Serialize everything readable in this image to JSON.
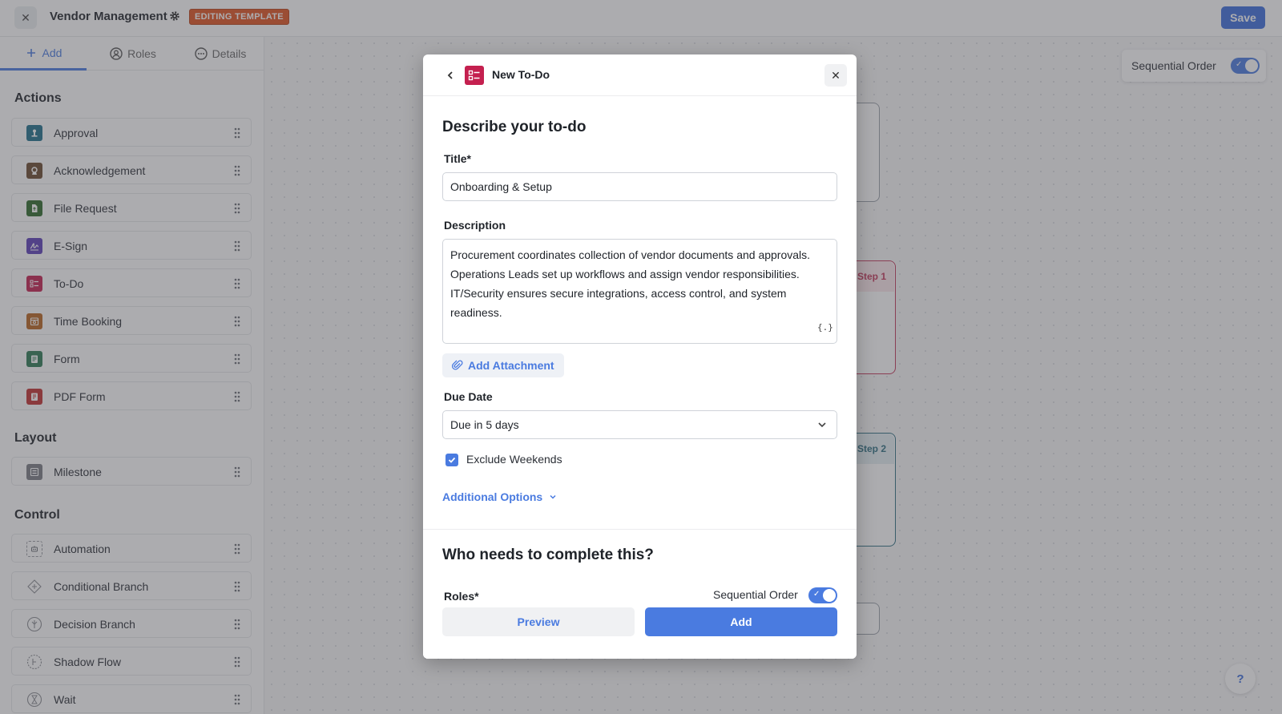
{
  "topbar": {
    "close_icon": "x-icon",
    "title": "Vendor Management",
    "settings_icon": "gear-icon",
    "badge": "EDITING TEMPLATE",
    "save_label": "Save"
  },
  "sidebar": {
    "tabs": [
      {
        "label": "Add",
        "icon": "plus-icon",
        "active": true
      },
      {
        "label": "Roles",
        "icon": "user-circle-icon",
        "active": false
      },
      {
        "label": "Details",
        "icon": "ellipsis-circle-icon",
        "active": false
      }
    ],
    "sections": [
      {
        "title": "Actions",
        "items": [
          {
            "label": "Approval",
            "icon": "approval-icon",
            "color": "#1f6f8b"
          },
          {
            "label": "Acknowledgement",
            "icon": "acknowledgement-icon",
            "color": "#6b4a2e"
          },
          {
            "label": "File Request",
            "icon": "file-request-icon",
            "color": "#2f6b2a"
          },
          {
            "label": "E-Sign",
            "icon": "signature-icon",
            "color": "#5b3fb8"
          },
          {
            "label": "To-Do",
            "icon": "todo-list-icon",
            "color": "#c4204f"
          },
          {
            "label": "Time Booking",
            "icon": "calendar-icon",
            "color": "#b8651f"
          },
          {
            "label": "Form",
            "icon": "form-icon",
            "color": "#2f7a55"
          },
          {
            "label": "PDF Form",
            "icon": "pdf-form-icon",
            "color": "#c23030"
          }
        ]
      },
      {
        "title": "Layout",
        "items": [
          {
            "label": "Milestone",
            "icon": "milestone-icon",
            "color": "#7a7d84"
          }
        ]
      },
      {
        "title": "Control",
        "items": [
          {
            "label": "Automation",
            "icon": "automation-icon",
            "color": "#9a9ca2"
          },
          {
            "label": "Conditional Branch",
            "icon": "conditional-branch-icon",
            "color": "#9a9ca2"
          },
          {
            "label": "Decision Branch",
            "icon": "decision-branch-icon",
            "color": "#9a9ca2"
          },
          {
            "label": "Shadow Flow",
            "icon": "shadow-flow-icon",
            "color": "#9a9ca2"
          },
          {
            "label": "Wait",
            "icon": "hourglass-icon",
            "color": "#9a9ca2"
          }
        ]
      }
    ]
  },
  "canvas": {
    "sequential_label": "Sequential Order",
    "sequential_on": true,
    "step1_label": "Step 1",
    "step2_label": "Step 2",
    "help_label": "?"
  },
  "modal": {
    "back_icon": "chevron-left-icon",
    "header_icon": "todo-list-icon",
    "header_title": "New To-Do",
    "close_icon": "x-icon",
    "section1_title": "Describe your to-do",
    "title_label": "Title*",
    "title_value": "Onboarding & Setup",
    "description_label": "Description",
    "description_value": "Procurement coordinates collection of vendor documents and approvals.\nOperations Leads set up workflows and assign vendor responsibilities.\nIT/Security ensures secure integrations, access control, and system readiness.",
    "variable_icon_text": "{.}",
    "attachment_label": "Add Attachment",
    "due_date_label": "Due Date",
    "due_date_value": "Due in 5 days",
    "exclude_weekends_label": "Exclude Weekends",
    "exclude_weekends_checked": true,
    "additional_options_label": "Additional Options",
    "section2_title": "Who needs to complete this?",
    "roles_label": "Roles*",
    "sequential_label": "Sequential Order",
    "sequential_on": true,
    "preview_label": "Preview",
    "add_label": "Add"
  },
  "colors": {
    "accent": "#4a7be0",
    "badge": "#e0531f",
    "save": "#3c6ddc",
    "todo": "#c4204f",
    "step1": "#c4385a",
    "step2": "#2f6f82"
  }
}
